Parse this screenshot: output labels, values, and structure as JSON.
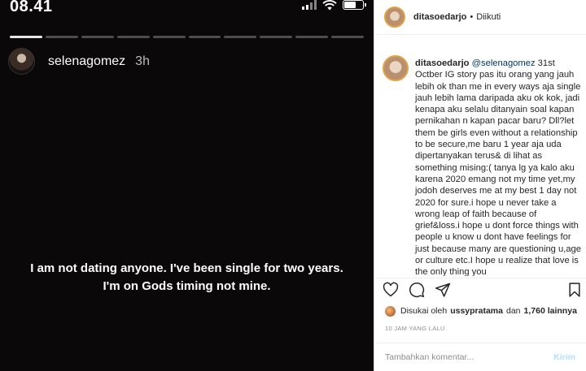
{
  "status_bar": {
    "time": "08.41"
  },
  "story": {
    "username": "selenagomez",
    "time_ago": "3h",
    "text_line1": "I am not dating anyone. I've been single for two years.",
    "text_line2": "I'm on Gods timing not mine.",
    "segments_total": 10,
    "segments_done": 1
  },
  "post": {
    "header": {
      "username": "ditasoedarjo",
      "separator": "•",
      "follow_status": "Diikuti"
    },
    "caption": {
      "username": "ditasoedarjo",
      "mention": "@selenagomez",
      "text": "31st Octber IG story pas itu orang yang jauh lebih ok than me in every ways aja single jauh lebih lama daripada aku ok kok, jadi kenapa aku selalu ditanyain soal kapan pernikahan n kapan pacar baru? Dll?let them be girls even without a relationship to be secure,me baru 1 year aja uda dipertanyakan terus& di lihat as something mising:( tanya lg ya kalo aku karena 2020 emang not my time yet,my jodoh deserves me at my best 1 day not 2020 for sure.i hope u never take a wrong leap of faith because of grief&loss.i hope u dont force things with people u know u dont have feelings for just because many are questioning u,age or culture etc.I hope u realize that love is the only thing you"
    },
    "likes": {
      "prefix": "Disukai oleh",
      "liker": "ussypratama",
      "conjunction": "dan",
      "others": "1,760 lainnya"
    },
    "date": "10 JAM YANG LALU",
    "comment_box": {
      "placeholder": "Tambahkan komentar...",
      "post_label": "Kirim"
    }
  }
}
